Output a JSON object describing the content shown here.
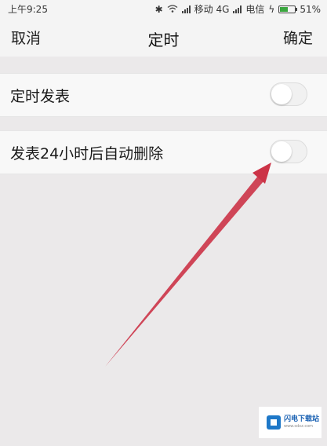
{
  "status_bar": {
    "time": "上午9:25",
    "carrier_1": "移动 4G",
    "carrier_2": "电信",
    "battery_percent": "51%",
    "battery_level": 0.51
  },
  "nav": {
    "cancel_label": "取消",
    "title": "定时",
    "confirm_label": "确定"
  },
  "settings": {
    "items": [
      {
        "label": "定时发表",
        "enabled": false
      },
      {
        "label": "发表24小时后自动删除",
        "enabled": false
      }
    ]
  },
  "annotation": {
    "color": "#cc3347"
  },
  "watermark": {
    "name": "闪电下载站",
    "site": "www.sdxz.com"
  },
  "colors": {
    "background": "#ebe9ea",
    "row_background": "#f8f8f8",
    "battery_green": "#3aa63f"
  }
}
